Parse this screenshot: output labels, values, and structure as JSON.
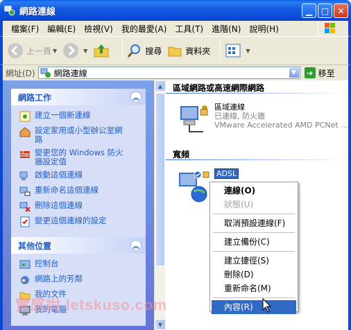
{
  "window": {
    "title": "網路連線"
  },
  "menubar": {
    "items": [
      "檔案(F)",
      "編輯(E)",
      "檢視(V)",
      "我的最愛(A)",
      "工具(T)",
      "進階(N)",
      "說明(H)"
    ]
  },
  "toolbar": {
    "back_label": "上一頁",
    "search_label": "搜尋",
    "folders_label": "資料夾"
  },
  "address": {
    "label": "網址(D)",
    "value": "網路連線",
    "go_label": "移至"
  },
  "left": {
    "network_tasks": {
      "title": "網路工作",
      "items": [
        {
          "label": "建立一個新連線",
          "icon": "new-connection-icon"
        },
        {
          "label": "設定家用或小型辦公室網\n路",
          "icon": "home-network-icon"
        },
        {
          "label": "變更您的 Windows 防火\n牆設定值",
          "icon": "firewall-icon"
        },
        {
          "label": "啟動這個連線",
          "icon": "connect-icon"
        },
        {
          "label": "重新命名這個連線",
          "icon": "rename-icon"
        },
        {
          "label": "刪除這個連線",
          "icon": "delete-icon"
        },
        {
          "label": "變更這個連線的設定",
          "icon": "settings-icon"
        }
      ]
    },
    "other_places": {
      "title": "其他位置",
      "items": [
        {
          "label": "控制台",
          "icon": "control-panel-icon"
        },
        {
          "label": "網路上的芳鄰",
          "icon": "network-places-icon"
        },
        {
          "label": "我的文件",
          "icon": "my-documents-icon"
        },
        {
          "label": "我的電腦",
          "icon": "my-computer-icon"
        }
      ]
    }
  },
  "right": {
    "lan_group": "區域網路或高速網際網路",
    "lan_conn": {
      "name": "區域連線",
      "status": "已連線, 防火牆",
      "device": "VMware Accelerated AMD PCNet ..."
    },
    "broadband_group": "寬頻",
    "adsl_conn": {
      "name": "ADSL"
    }
  },
  "context_menu": {
    "items": [
      {
        "label": "連線(O)",
        "state": "default"
      },
      {
        "label": "狀態(U)",
        "state": "disabled"
      },
      {
        "label": "取消預設連線(F)",
        "state": "normal"
      },
      {
        "label": "建立備份(C)",
        "state": "normal"
      },
      {
        "label": "建立捷徑(S)",
        "state": "normal"
      },
      {
        "label": "刪除(D)",
        "state": "normal"
      },
      {
        "label": "重新命名(M)",
        "state": "normal"
      },
      {
        "label": "內容(R)",
        "state": "hover"
      }
    ]
  },
  "watermark": "實感說 letskuso.com",
  "colors": {
    "title_blue": "#0a48d4",
    "task_link": "#215dc6",
    "highlight": "#316ac5"
  }
}
